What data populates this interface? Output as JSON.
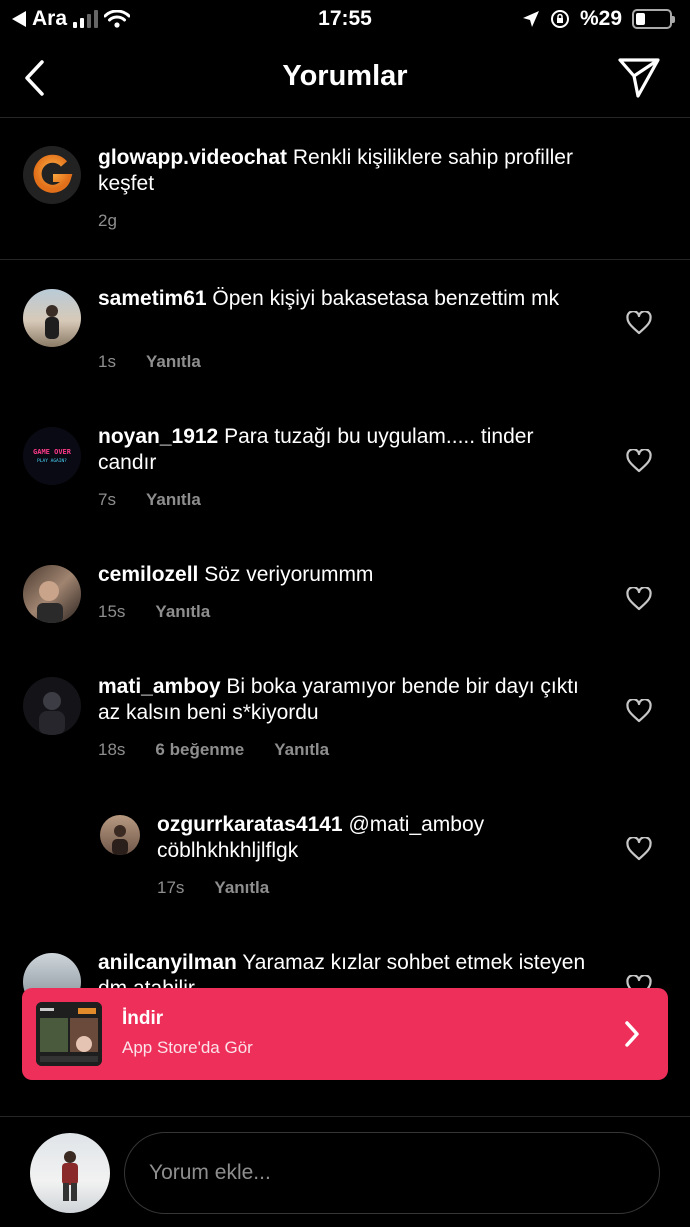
{
  "status_bar": {
    "carrier": "Ara",
    "time": "17:55",
    "battery": "%29",
    "battery_level": 0.29
  },
  "header": {
    "title": "Yorumlar",
    "back_icon": "chevron-left-icon",
    "send_icon": "paper-plane-icon"
  },
  "caption": {
    "username": "glowapp.videochat",
    "text": "Renkli kişiliklere sahip profiller keşfet",
    "time": "2g"
  },
  "comments": [
    {
      "username": "sametim61",
      "text": "Öpen kişiyi bakasetasa benzettim mk",
      "time": "1s",
      "likes": "",
      "reply": "Yanıtla"
    },
    {
      "username": "noyan_1912",
      "text": "Para tuzağı bu uygulam..... tinder candır",
      "time": "7s",
      "likes": "",
      "reply": "Yanıtla",
      "avatar_text_1": "GAME OVER",
      "avatar_text_2": "PLAY AGAIN?"
    },
    {
      "username": "cemilozell",
      "text": "Söz veriyorummm",
      "time": "15s",
      "likes": "",
      "reply": "Yanıtla"
    },
    {
      "username": "mati_amboy",
      "text": "Bi boka yaramıyor bende bir dayı çıktı az kalsın beni s*kiyordu",
      "time": "18s",
      "likes": "6 beğenme",
      "reply": "Yanıtla"
    },
    {
      "username": "ozgurrkaratas4141",
      "text": "@mati_amboy cöblhkhkhljlflgk",
      "time": "17s",
      "likes": "",
      "reply": "Yanıtla"
    },
    {
      "username": "anilcanyilman",
      "text": "Yaramaz kızlar sohbet etmek isteyen dm atabilir",
      "time": "",
      "likes": "",
      "reply": ""
    }
  ],
  "banner": {
    "title": "İndir",
    "subtitle": "App Store'da Gör",
    "color": "#ee2f5a"
  },
  "input": {
    "placeholder": "Yorum ekle..."
  }
}
